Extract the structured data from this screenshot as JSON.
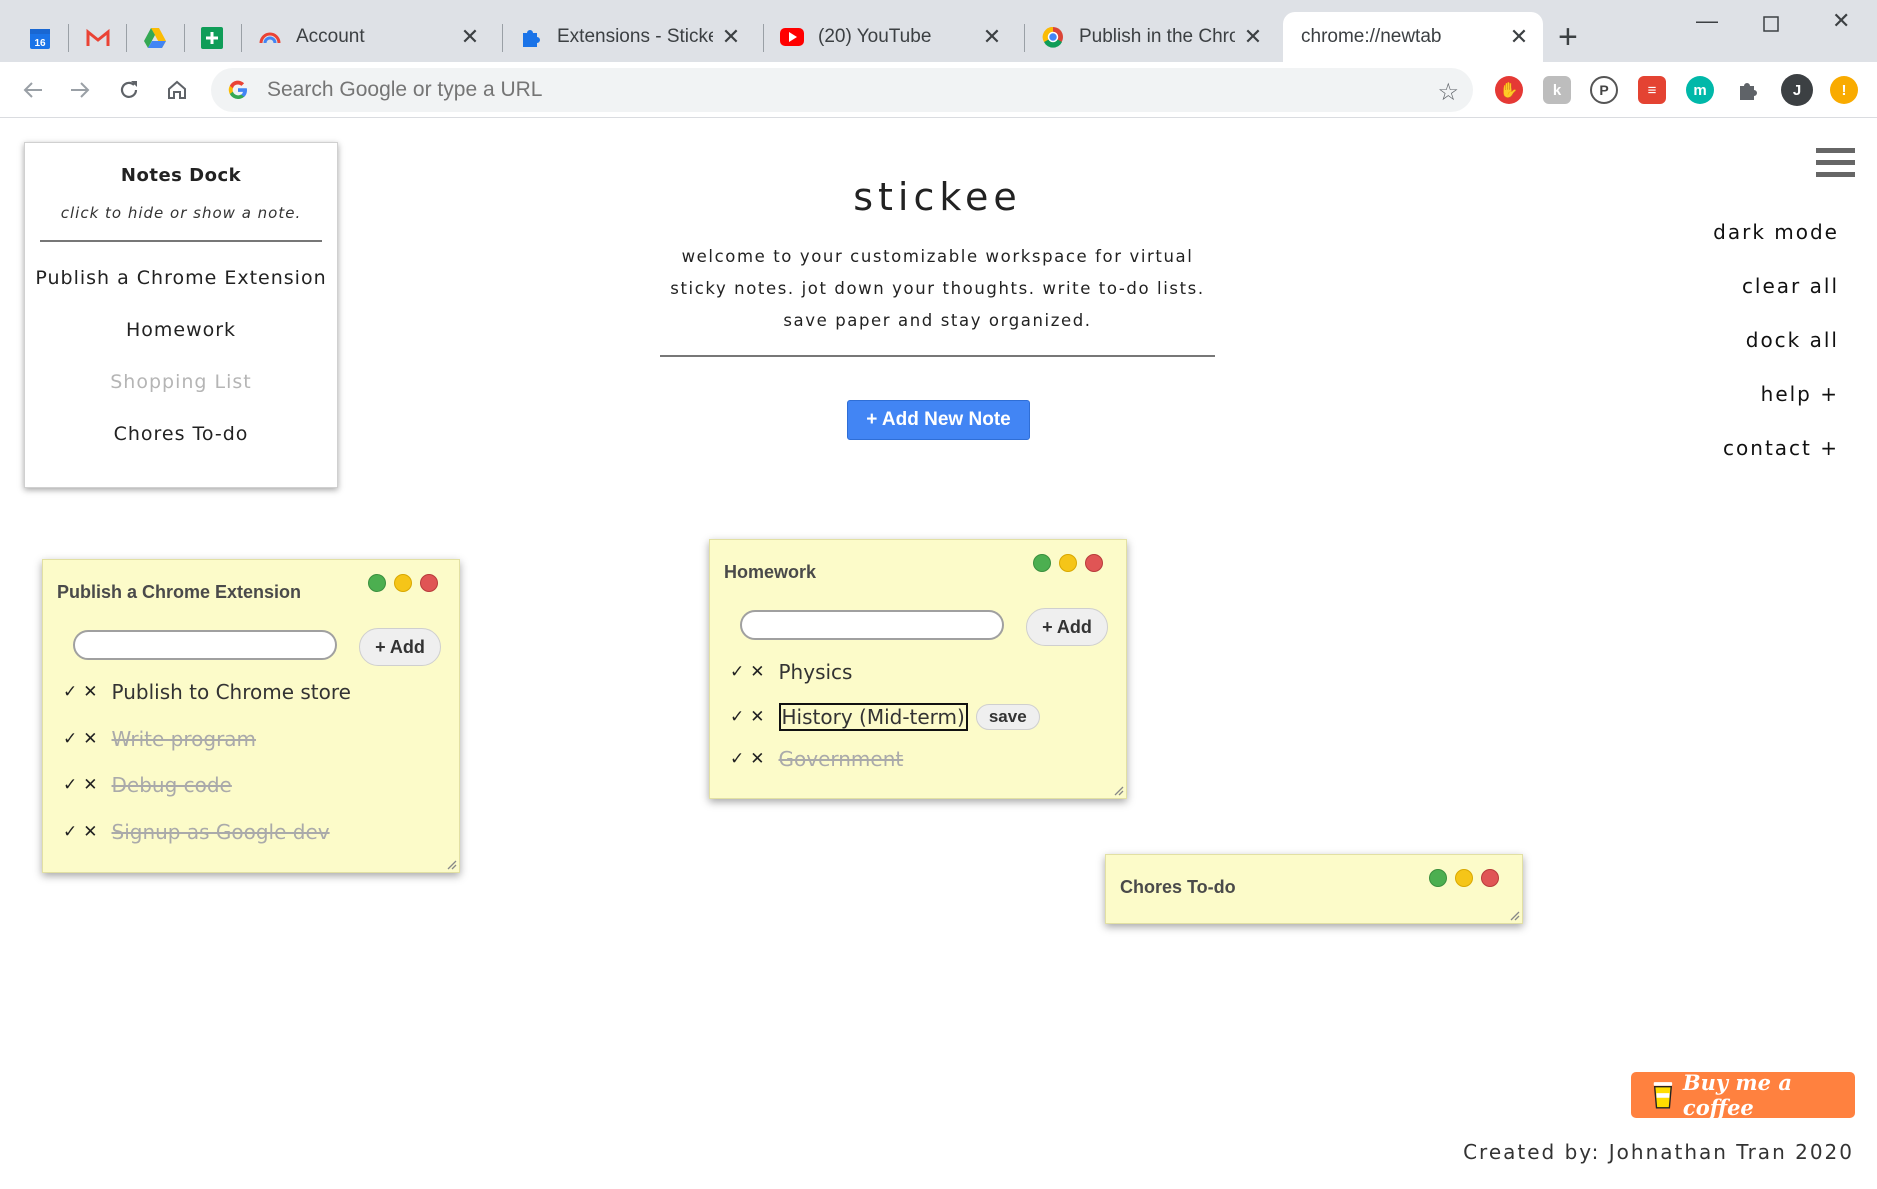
{
  "browser": {
    "pinned_tabs": [
      {
        "name": "google-calendar",
        "badge": "16"
      },
      {
        "name": "gmail"
      },
      {
        "name": "google-drive"
      },
      {
        "name": "google-sheets"
      }
    ],
    "tabs": [
      {
        "title": "Account",
        "icon": "google-account-icon"
      },
      {
        "title": "Extensions - Stickee",
        "icon": "puzzle-icon"
      },
      {
        "title": "(20) YouTube",
        "icon": "youtube-icon"
      },
      {
        "title": "Publish in the Chrome",
        "icon": "chrome-icon"
      },
      {
        "title": "chrome://newtab",
        "active": true
      }
    ],
    "omnibox_placeholder": "Search Google or type a URL",
    "profile_initial": "J",
    "alert_badge": "!"
  },
  "dock": {
    "title": "Notes Dock",
    "subtitle": "click to hide or show a note.",
    "items": [
      {
        "label": "Publish a Chrome Extension",
        "hidden": false
      },
      {
        "label": "Homework",
        "hidden": false
      },
      {
        "label": "Shopping List",
        "hidden": true
      },
      {
        "label": "Chores To-do",
        "hidden": false
      }
    ]
  },
  "header": {
    "brand": "stickee",
    "tagline": "welcome to your customizable workspace for virtual sticky notes. jot down your thoughts. write to-do lists. save paper and stay organized.",
    "add_note_label": "+ Add New Note"
  },
  "menu": {
    "items": [
      "dark mode",
      "clear all",
      "dock all",
      "help +",
      "contact +"
    ]
  },
  "notes": {
    "chrome": {
      "title": "Publish a Chrome Extension",
      "add_label": "+ Add",
      "items": [
        {
          "text": "Publish to Chrome store",
          "done": false
        },
        {
          "text": "Write program",
          "done": true
        },
        {
          "text": "Debug code",
          "done": true
        },
        {
          "text": "Signup as Google dev",
          "done": true
        }
      ]
    },
    "homework": {
      "title": "Homework",
      "add_label": "+ Add",
      "save_label": "save",
      "items": [
        {
          "text": "Physics",
          "done": false
        },
        {
          "text": "History (Mid-term)",
          "done": false,
          "editing": true
        },
        {
          "text": "Government",
          "done": true
        }
      ]
    },
    "chores": {
      "title": "Chores To-do"
    }
  },
  "footer": {
    "coffee_label": "Buy me a coffee",
    "credit": "Created by: Johnathan Tran 2020"
  },
  "colors": {
    "note_bg": "#fcfbc9",
    "accent": "#4285f4",
    "coffee": "#ff813f"
  }
}
